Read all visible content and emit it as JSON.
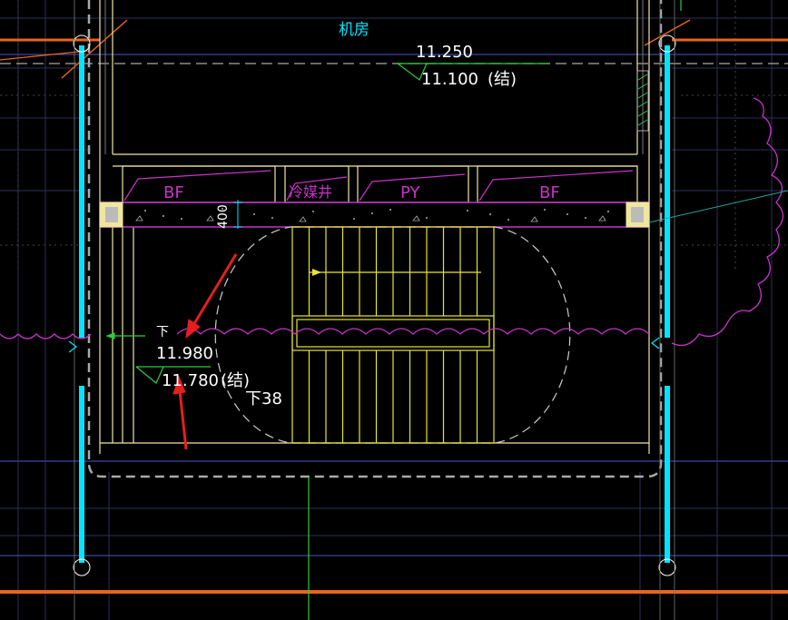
{
  "drawing": {
    "room_label": "机房",
    "elevation_top": {
      "finish": "11.250",
      "structure": "11.100",
      "note": "(结)"
    },
    "shafts": [
      "BF",
      "冷媒井",
      "PY",
      "BF"
    ],
    "slab_thickness": "400",
    "landing": {
      "down_label": "下",
      "finish": "11.980",
      "structure": "11.780",
      "note": "(结)"
    },
    "stair_label": "下38",
    "colors": {
      "background": "#000000",
      "wall": "#f0e6a0",
      "column": "#00e5ff",
      "magenta": "#c832c8",
      "green": "#2ecc40",
      "orange": "#e8641e",
      "blue_grid": "#3c46a0",
      "red_arrow": "#e61e1e",
      "text_white": "#ffffff",
      "stair_yellow": "#e6e632"
    }
  }
}
